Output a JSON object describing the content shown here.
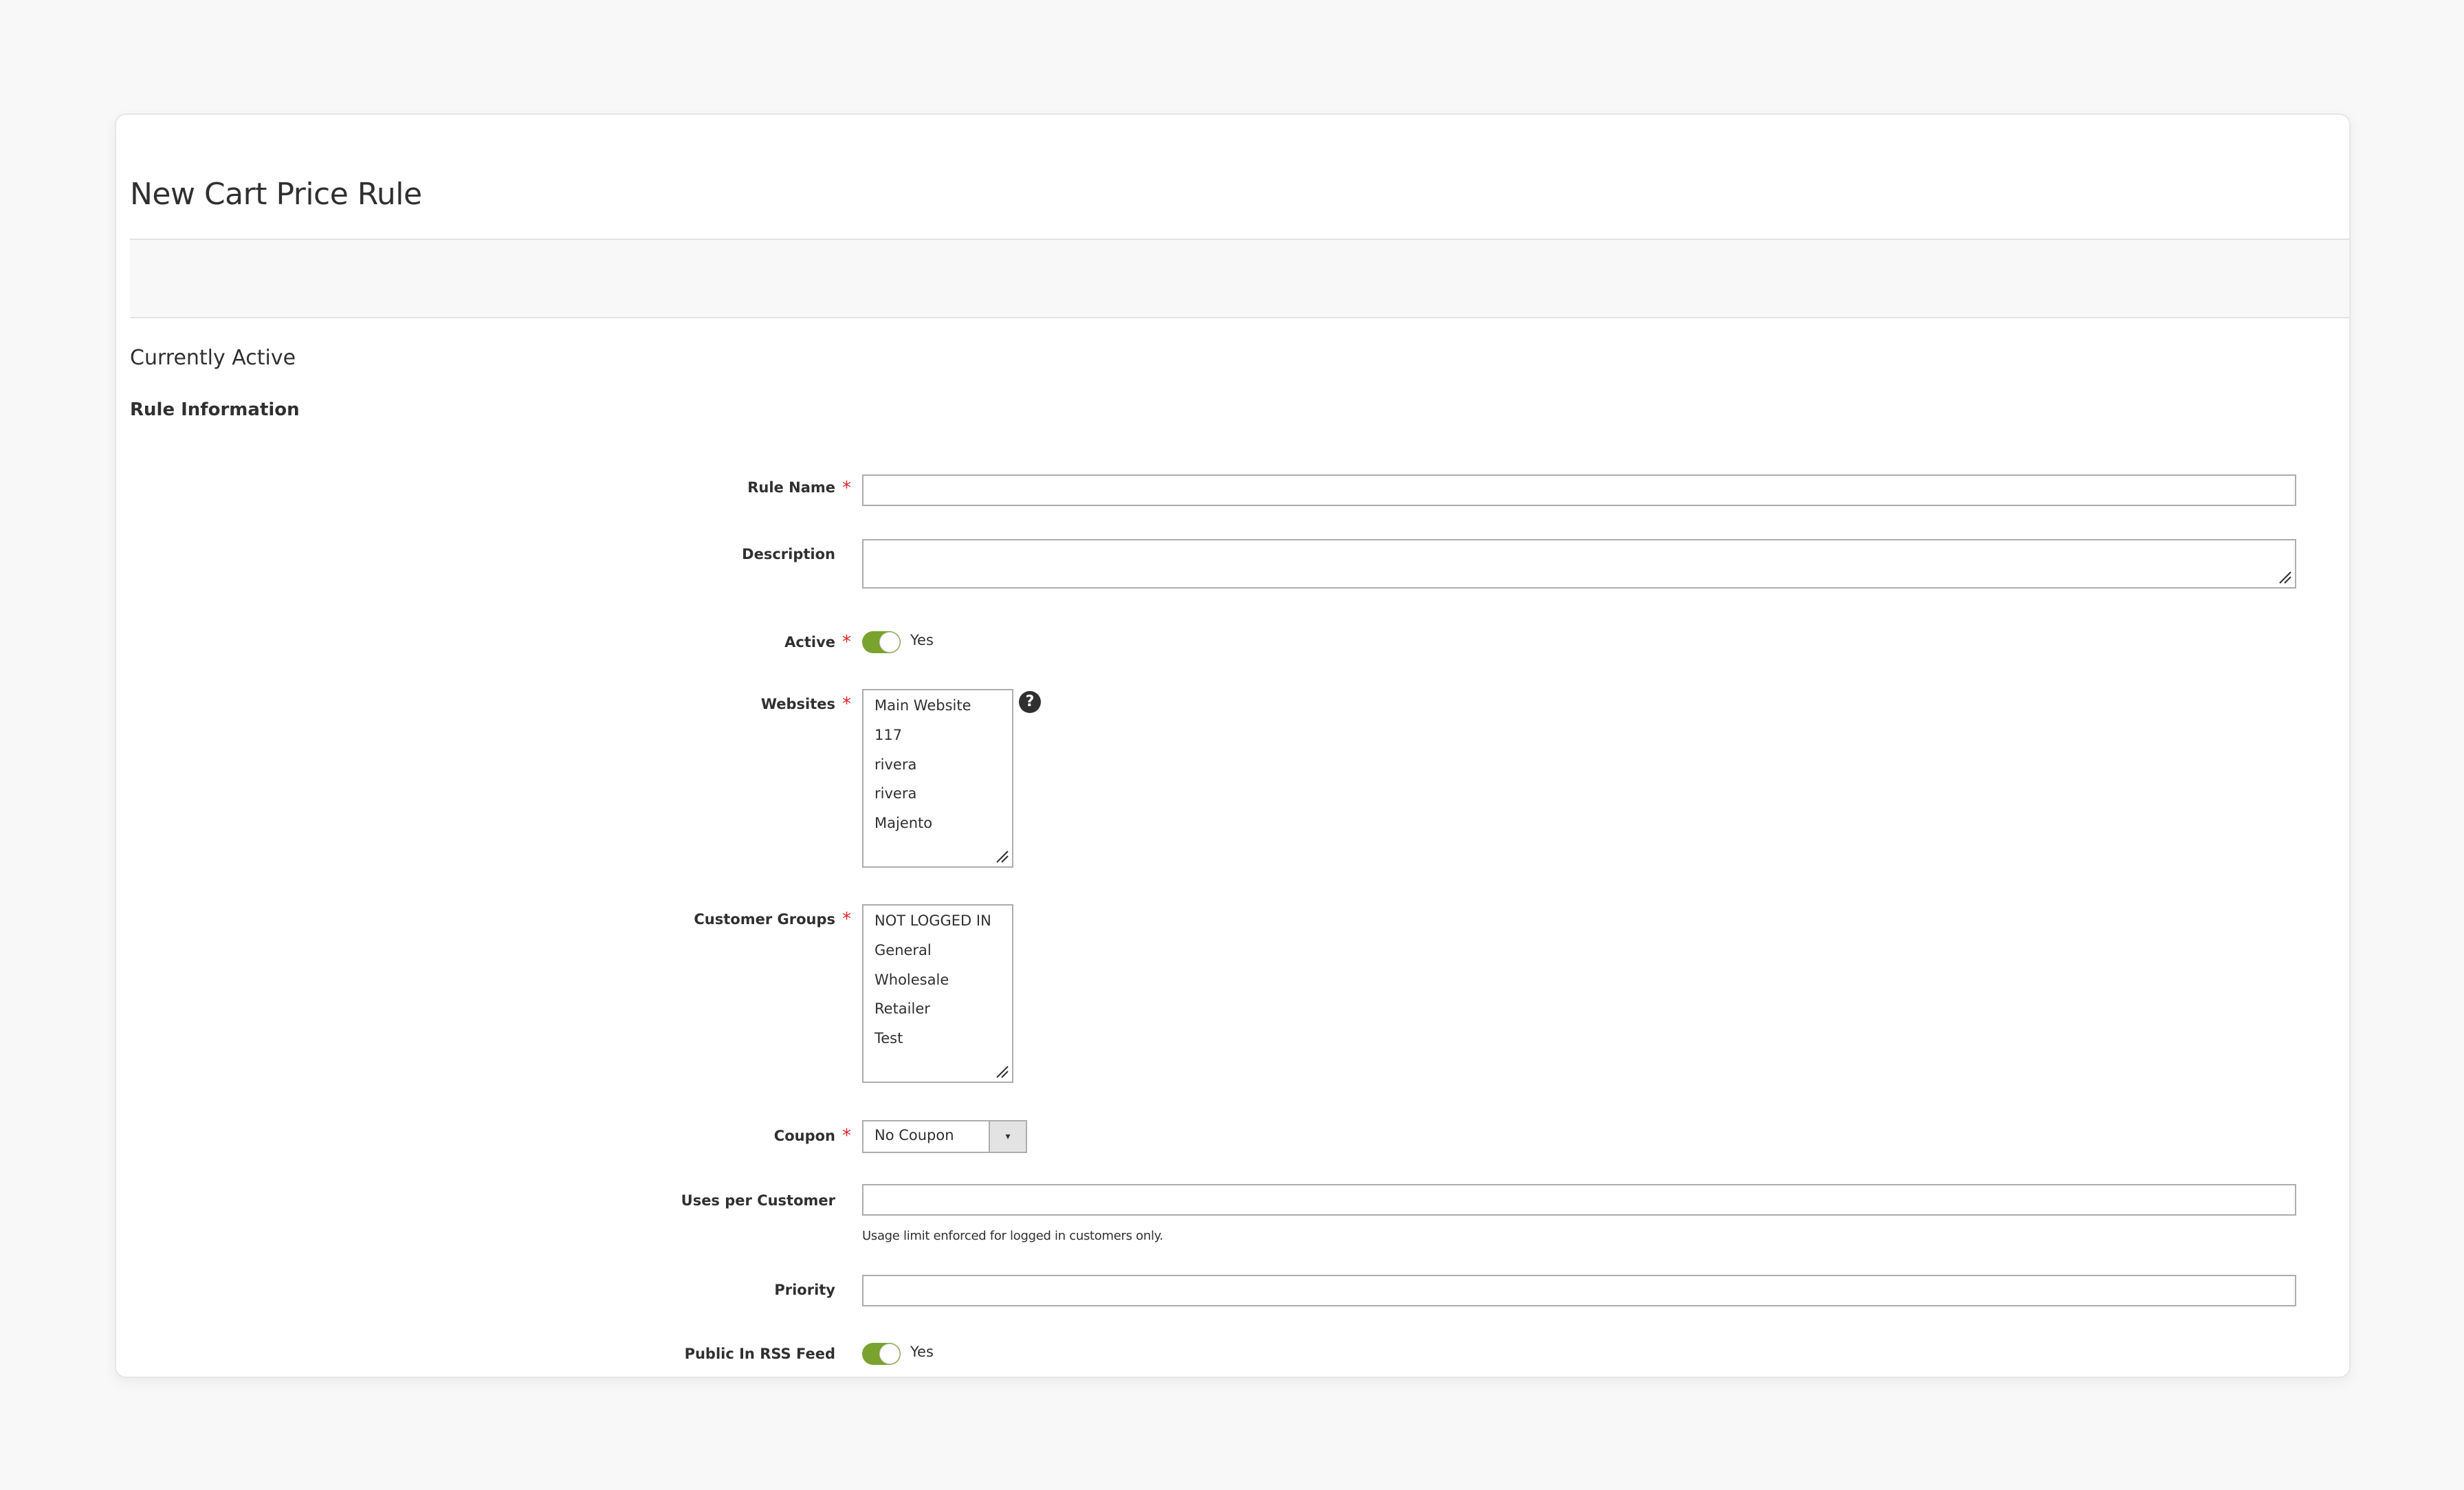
{
  "page": {
    "title": "New Cart Price Rule",
    "status": "Currently Active",
    "section_title": "Rule Information"
  },
  "form": {
    "rule_name": {
      "label": "Rule Name",
      "value": ""
    },
    "description": {
      "label": "Description",
      "value": ""
    },
    "active": {
      "label": "Active",
      "state": "Yes"
    },
    "websites": {
      "label": "Websites",
      "options": [
        "Main Website",
        "117",
        "rivera",
        "rivera",
        "Majento"
      ]
    },
    "customer_groups": {
      "label": "Customer Groups",
      "options": [
        "NOT LOGGED IN",
        "General",
        "Wholesale",
        "Retailer",
        "Test"
      ]
    },
    "coupon": {
      "label": "Coupon",
      "value": "No Coupon",
      "arrow": "▾"
    },
    "uses_per_customer": {
      "label": "Uses per Customer",
      "value": "",
      "note": "Usage limit enforced for logged in customers only."
    },
    "priority": {
      "label": "Priority",
      "value": ""
    },
    "public_in_rss": {
      "label": "Public In RSS Feed",
      "state": "Yes"
    }
  },
  "icons": {
    "help": "?",
    "required": "*"
  },
  "colors": {
    "toggle_on": "#79a22e",
    "required": "#e22626"
  }
}
